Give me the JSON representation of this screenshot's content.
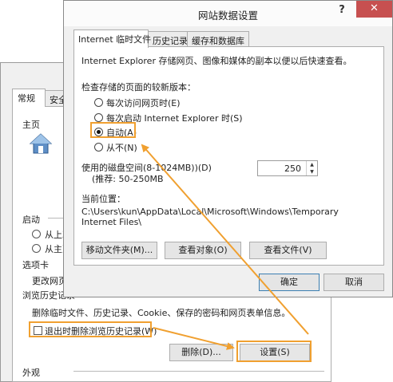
{
  "background_window": {
    "tabs": [
      "常规",
      "安全"
    ],
    "homepage_label": "主页",
    "startup_label": "启动",
    "startup_options": [
      "从上次",
      "从主页"
    ],
    "tabs_section_label": "选项卡",
    "tabs_change_text": "更改网页",
    "history_label": "浏览历史记录",
    "history_desc": "删除临时文件、历史记录、Cookie、保存的密码和网页表单信息。",
    "delete_on_exit_label": "退出时删除浏览历史记录(W)",
    "delete_button": "删除(D)...",
    "settings_button": "设置(S)",
    "appearance_label": "外观"
  },
  "dialog": {
    "title": "网站数据设置",
    "help_glyph": "?",
    "close_glyph": "✕",
    "tabs": [
      "Internet 临时文件",
      "历史记录",
      "缓存和数据库"
    ],
    "description": "Internet Explorer 存储网页、图像和媒体的副本以便以后快速查看。",
    "check_label": "检查存储的页面的较新版本：",
    "options": [
      "每次访问网页时(E)",
      "每次启动 Internet Explorer 时(S)",
      "自动(A)",
      "从不(N)"
    ],
    "selected_option": "自动(A)",
    "disk_space_label": "使用的磁盘空间(8-1024MB))(D)",
    "recommended": "(推荐: 50-250MB",
    "disk_space_value": "250",
    "location_label": "当前位置：",
    "location_path_line1": "C:\\Users\\kun\\AppData\\Local\\Microsoft\\Windows\\Temporary",
    "location_path_line2": "Internet Files\\",
    "move_folder_button": "移动文件夹(M)...",
    "view_objects_button": "查看对象(O)",
    "view_files_button": "查看文件(V)",
    "ok_button": "确定",
    "cancel_button": "取消"
  },
  "colors": {
    "highlight": "#f0a030",
    "close_button": "#c75050",
    "window_bg": "#f0f0f0"
  },
  "icons": {
    "homepage": "house-icon",
    "spinner": "spin-arrows-icon"
  }
}
